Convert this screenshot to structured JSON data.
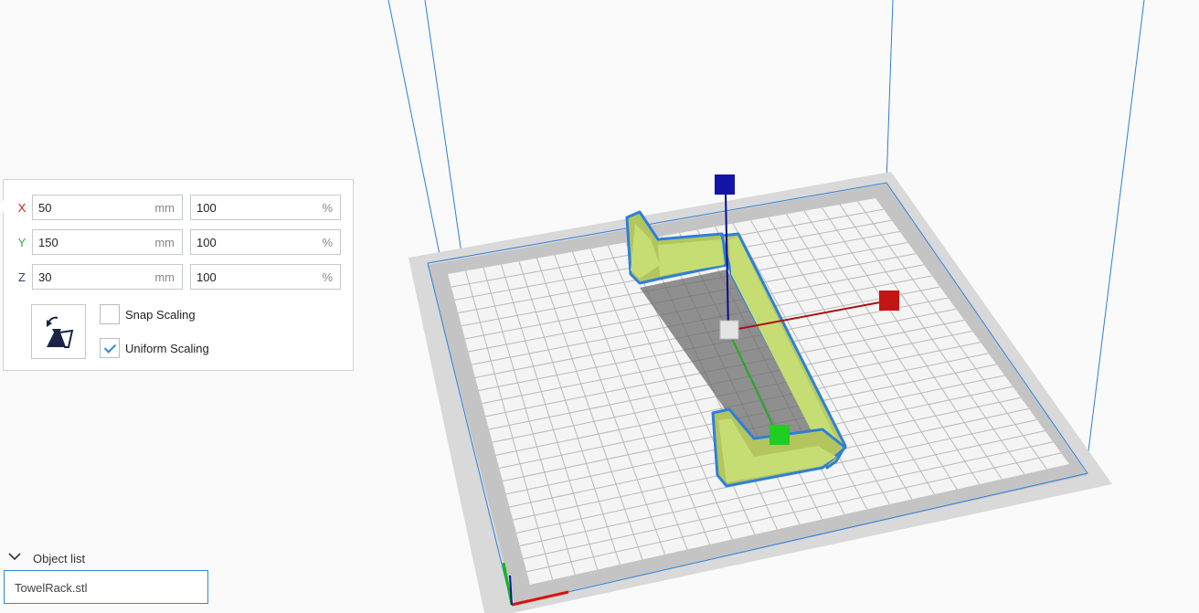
{
  "scale_tool": {
    "rows": [
      {
        "axis": "X",
        "color": "#cc2222",
        "value_mm": "50",
        "unit_mm": "mm",
        "value_pct": "100",
        "unit_pct": "%"
      },
      {
        "axis": "Y",
        "color": "#2fae2f",
        "value_mm": "150",
        "unit_mm": "mm",
        "value_pct": "100",
        "unit_pct": "%"
      },
      {
        "axis": "Z",
        "color": "#2f3f7f",
        "value_mm": "30",
        "unit_mm": "mm",
        "value_pct": "100",
        "unit_pct": "%"
      }
    ],
    "reset_icon": "reset-scale-icon",
    "snap_scaling": {
      "label": "Snap Scaling",
      "checked": false
    },
    "uniform_scaling": {
      "label": "Uniform Scaling",
      "checked": true
    }
  },
  "object_list": {
    "header": "Object list",
    "collapse_icon": "chevron-down-icon",
    "items": [
      "TowelRack.stl"
    ]
  },
  "viewport": {
    "model_color": "#c6dd73",
    "outline_color": "#2f7fd8",
    "axis_colors": {
      "x": "#cc1111",
      "y": "#11bb11",
      "z": "#1111aa"
    }
  }
}
